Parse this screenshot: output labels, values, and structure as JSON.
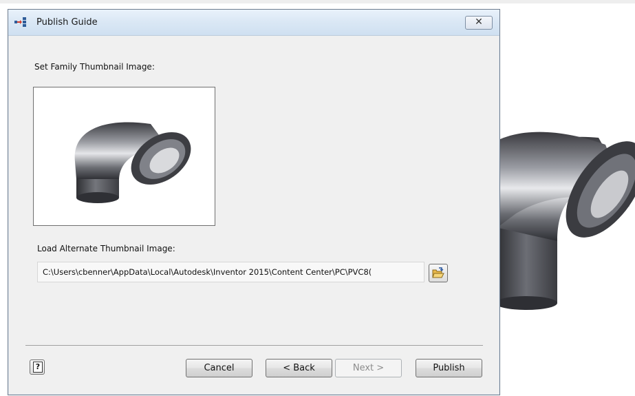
{
  "dialog": {
    "title": "Publish Guide",
    "close_label": "✕"
  },
  "thumbnail": {
    "label": "Set Family Thumbnail Image:"
  },
  "alternate": {
    "label": "Load Alternate Thumbnail Image:",
    "path": "C:\\Users\\cbenner\\AppData\\Local\\Autodesk\\Inventor 2015\\Content Center\\PC\\PVC8("
  },
  "footer": {
    "help_label": "?",
    "cancel_label": "Cancel",
    "back_label": "< Back",
    "next_label": "Next >",
    "next_disabled": true,
    "publish_label": "Publish"
  },
  "icons": {
    "title": "publish-guide-icon",
    "browse": "open-folder-icon",
    "help": "help-icon",
    "close": "close-icon",
    "preview": "pipe-elbow-model"
  }
}
